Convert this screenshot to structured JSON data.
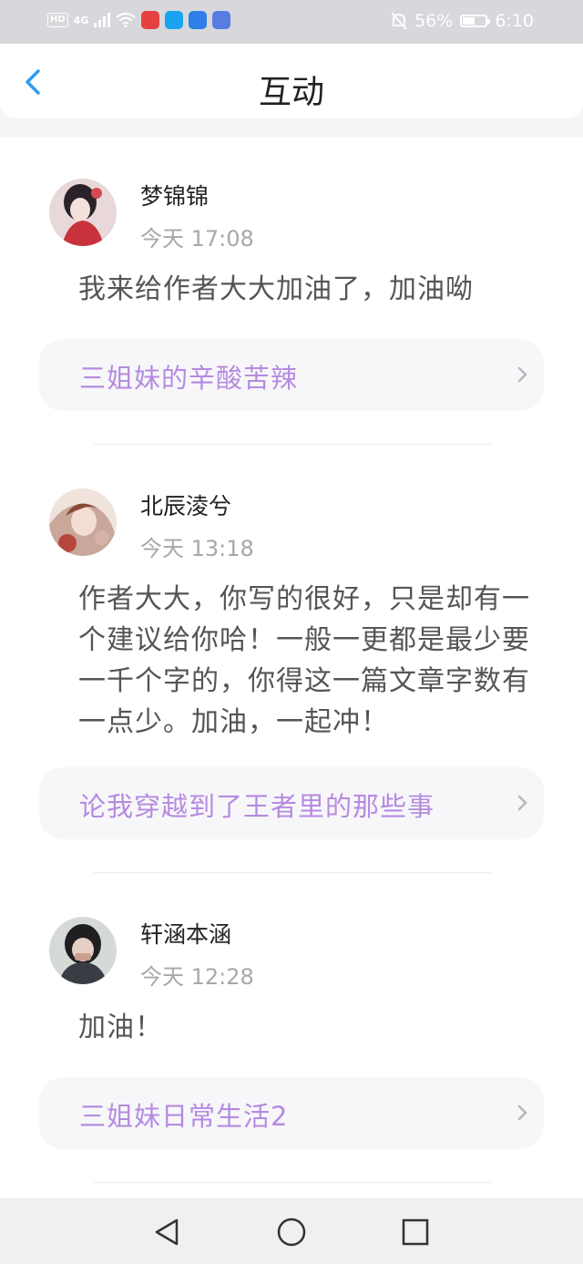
{
  "status_bar": {
    "hd": "HD",
    "network": "4G",
    "battery_percent": "56%",
    "battery_level": 0.56,
    "time": "6:10"
  },
  "header": {
    "title": "互动"
  },
  "comments": [
    {
      "user": "梦锦锦",
      "time": "今天 17:08",
      "text": "我来给作者大大加油了，加油呦",
      "article": "三姐妹的辛酸苦辣"
    },
    {
      "user": "北辰淩兮",
      "time": "今天 13:18",
      "text": "作者大大，你写的很好，只是却有一个建议给你哈！一般一更都是最少要一千个字的，你得这一篇文章字数有一点少。加油，一起冲！",
      "article": "论我穿越到了王者里的那些事"
    },
    {
      "user": "轩涵本涵",
      "time": "今天 12:28",
      "text": "加油！",
      "article": "三姐妹日常生活2"
    }
  ],
  "colors": {
    "accent_blue": "#2f9bf0",
    "article_purple": "#b58be0"
  }
}
